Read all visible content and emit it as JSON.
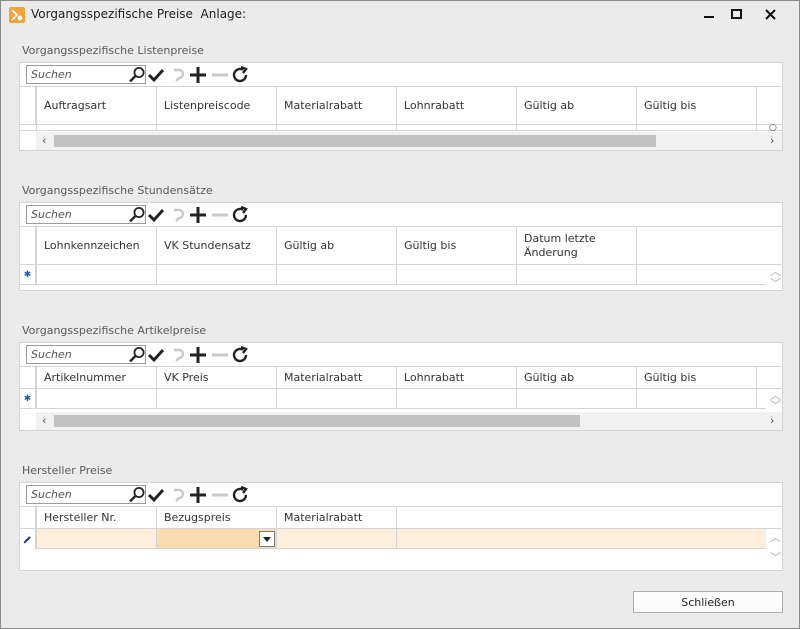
{
  "window": {
    "title": "Vorgangsspezifische Preise  Anlage:",
    "controls": {
      "minimize_icon": "minimize-icon",
      "maximize_icon": "maximize-icon",
      "close_icon": "close-icon"
    }
  },
  "toolbar": {
    "search_placeholder": "Suchen",
    "icons": [
      "search-icon",
      "check-icon",
      "undo-icon",
      "plus-icon",
      "minus-icon",
      "refresh-icon"
    ]
  },
  "sections": {
    "listenpreise": {
      "label": "Vorgangsspezifische Listenpreise",
      "columns": [
        "Auftragsart",
        "Listenpreiscode",
        "Materialrabatt",
        "Lohnrabatt",
        "Gültig ab",
        "Gültig bis"
      ]
    },
    "stundensaetze": {
      "label": "Vorgangsspezifische Stundensätze",
      "columns": [
        "Lohnkennzeichen",
        "VK Stundensatz",
        "Gültig ab",
        "Gültig bis",
        "Datum letzte Änderung"
      ],
      "new_row_marker": "✱"
    },
    "artikelpreise": {
      "label": "Vorgangsspezifische Artikelpreise",
      "columns": [
        "Artikelnummer",
        "VK Preis",
        "Materialrabatt",
        "Lohnrabatt",
        "Gültig ab",
        "Gültig bis"
      ],
      "new_row_marker": "✱"
    },
    "hersteller": {
      "label": "Hersteller Preise",
      "columns": [
        "Hersteller Nr.",
        "Bezugspreis",
        "Materialrabatt"
      ],
      "edit_row_marker": "pencil-icon",
      "highlight_color": "#fdefdc",
      "active_cell_color": "#fbdcb0"
    }
  },
  "footer": {
    "close_label": "Schließen"
  },
  "colors": {
    "accent": "#f2a33a",
    "grid_line": "#d4d4d4",
    "background": "#ebebeb"
  }
}
